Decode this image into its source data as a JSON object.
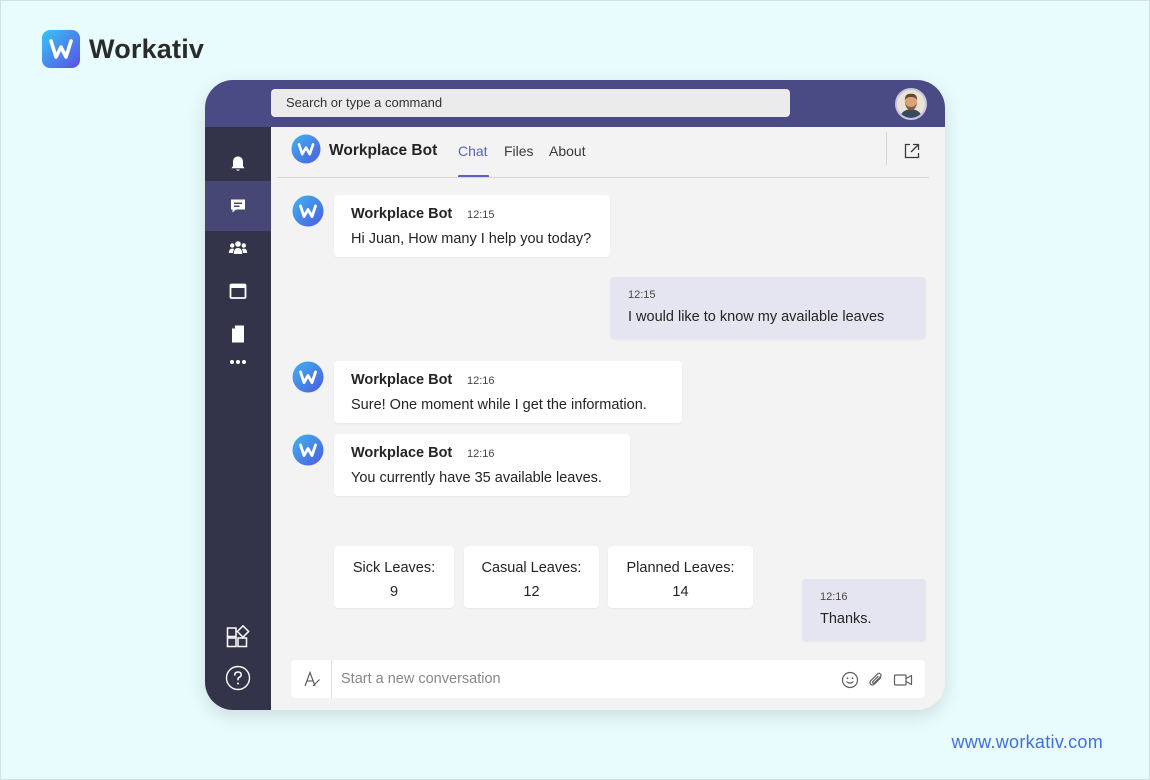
{
  "brand": {
    "name": "Workativ",
    "website": "www.workativ.com",
    "accent": "#3f6fe0"
  },
  "topbar": {
    "search_placeholder": "Search or type a command",
    "color": "#4a4a85"
  },
  "siderail": {
    "items": [
      {
        "icon": "bell-icon",
        "label": "Activity"
      },
      {
        "icon": "chat-icon",
        "label": "Chat",
        "active": true
      },
      {
        "icon": "teams-icon",
        "label": "Teams"
      },
      {
        "icon": "calendar-icon",
        "label": "Calendar"
      },
      {
        "icon": "files-icon",
        "label": "Files"
      },
      {
        "icon": "more-icon",
        "label": "More"
      },
      {
        "icon": "apps-icon",
        "label": "Apps"
      },
      {
        "icon": "help-icon",
        "label": "Help"
      }
    ]
  },
  "chat_header": {
    "title": "Workplace Bot",
    "tabs": [
      {
        "label": "Chat",
        "active": true
      },
      {
        "label": "Files"
      },
      {
        "label": "About"
      }
    ]
  },
  "messages": [
    {
      "from": "bot",
      "name": "Workplace Bot",
      "time": "12:15",
      "text": "Hi Juan, How many I help you today?"
    },
    {
      "from": "me",
      "time": "12:15",
      "text": "I would like to know my available leaves"
    },
    {
      "from": "bot",
      "name": "Workplace Bot",
      "time": "12:16",
      "text": "Sure! One moment while I get the information."
    },
    {
      "from": "bot",
      "name": "Workplace Bot",
      "time": "12:16",
      "text": "You currently have 35 available leaves."
    },
    {
      "from": "me",
      "time": "12:16",
      "text": "Thanks."
    }
  ],
  "leave_cards": [
    {
      "label": "Sick Leaves:",
      "value": "9"
    },
    {
      "label": "Casual Leaves:",
      "value": "12"
    },
    {
      "label": "Planned Leaves:",
      "value": "14"
    }
  ],
  "compose": {
    "placeholder": "Start a new conversation"
  }
}
